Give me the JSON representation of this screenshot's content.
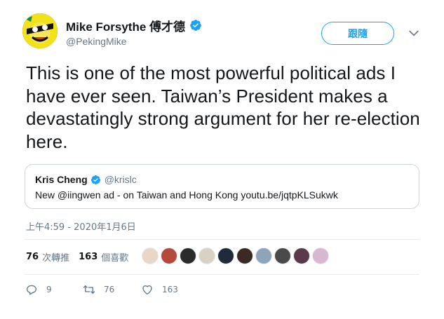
{
  "user": {
    "display_name": "Mike Forsythe 傅才德",
    "handle": "@PekingMike"
  },
  "follow_button": "跟隨",
  "tweet_text": "This is one of the most powerful political ads I have ever seen. Taiwan’s President makes a devastatingly strong argument for her re-election here.",
  "quoted_tweet": {
    "name": "Kris Cheng",
    "handle": "@krislc",
    "text": "New @iingwen ad - on Taiwan and Hong Kong youtu.be/jqtpKLSukwk"
  },
  "timestamp": "上午4:59 - 2020年1月6日",
  "stats": {
    "retweets_count": "76",
    "retweets_label": "次轉推",
    "likes_count": "163",
    "likes_label": "個喜歡"
  },
  "liker_colors": [
    "#e8d7c8",
    "#b54a3a",
    "#2b2b2b",
    "#d9d2c4",
    "#1f2a3a",
    "#3a2a22",
    "#8ea4b8",
    "#4a4a4a",
    "#5a3a4a",
    "#d8b8d0"
  ],
  "actions": {
    "replies": "9",
    "retweets": "76",
    "likes": "163"
  },
  "colors": {
    "accent": "#1da1f2",
    "secondary_text": "#657786",
    "border": "#ccd6dd"
  }
}
